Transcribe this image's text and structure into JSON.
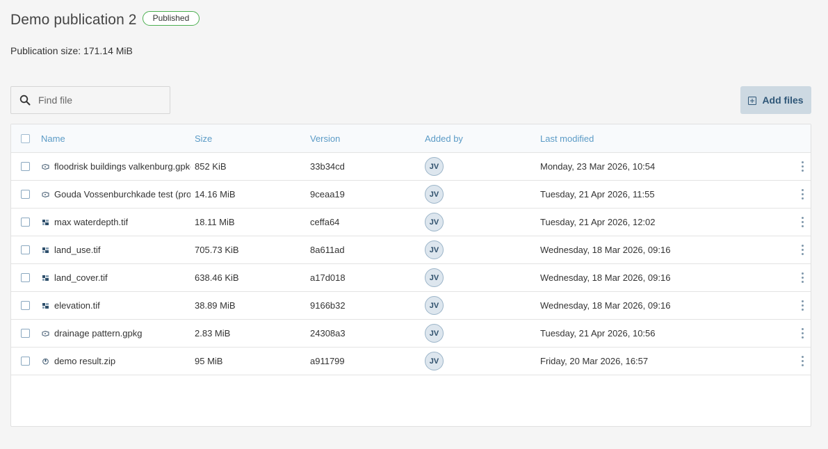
{
  "header": {
    "title": "Demo publication 2",
    "status": "Published",
    "size_text": "Publication size: 171.14 MiB"
  },
  "search": {
    "placeholder": "Find file",
    "value": ""
  },
  "actions": {
    "add_files_label": "Add files"
  },
  "table": {
    "columns": {
      "name": "Name",
      "size": "Size",
      "version": "Version",
      "added_by": "Added by",
      "last_modified": "Last modified"
    },
    "rows": [
      {
        "icon": "vector-icon",
        "name": "floodrisk buildings valkenburg.gpkg",
        "size": "852 KiB",
        "version": "33b34cd",
        "added_by": "JV",
        "modified": "Monday, 23 Mar 2026, 10:54"
      },
      {
        "icon": "vector-icon",
        "name": "Gouda Vossenburchkade test (processed).gpkg",
        "size": "14.16 MiB",
        "version": "9ceaa19",
        "added_by": "JV",
        "modified": "Tuesday, 21 Apr 2026, 11:55"
      },
      {
        "icon": "raster-icon",
        "name": "max waterdepth.tif",
        "size": "18.11 MiB",
        "version": "ceffa64",
        "added_by": "JV",
        "modified": "Tuesday, 21 Apr 2026, 12:02"
      },
      {
        "icon": "raster-icon",
        "name": "land_use.tif",
        "size": "705.73 KiB",
        "version": "8a611ad",
        "added_by": "JV",
        "modified": "Wednesday, 18 Mar 2026, 09:16"
      },
      {
        "icon": "raster-icon",
        "name": "land_cover.tif",
        "size": "638.46 KiB",
        "version": "a17d018",
        "added_by": "JV",
        "modified": "Wednesday, 18 Mar 2026, 09:16"
      },
      {
        "icon": "raster-icon",
        "name": "elevation.tif",
        "size": "38.89 MiB",
        "version": "9166b32",
        "added_by": "JV",
        "modified": "Wednesday, 18 Mar 2026, 09:16"
      },
      {
        "icon": "vector-icon",
        "name": "drainage pattern.gpkg",
        "size": "2.83 MiB",
        "version": "24308a3",
        "added_by": "JV",
        "modified": "Tuesday, 21 Apr 2026, 10:56"
      },
      {
        "icon": "zip-icon",
        "name": "demo result.zip",
        "size": "95 MiB",
        "version": "a911799",
        "added_by": "JV",
        "modified": "Friday, 20 Mar 2026, 16:57"
      }
    ]
  },
  "colors": {
    "header_text": "#5b9bc6",
    "published_border": "#4caf50",
    "add_button_bg": "#cdd9e2"
  }
}
